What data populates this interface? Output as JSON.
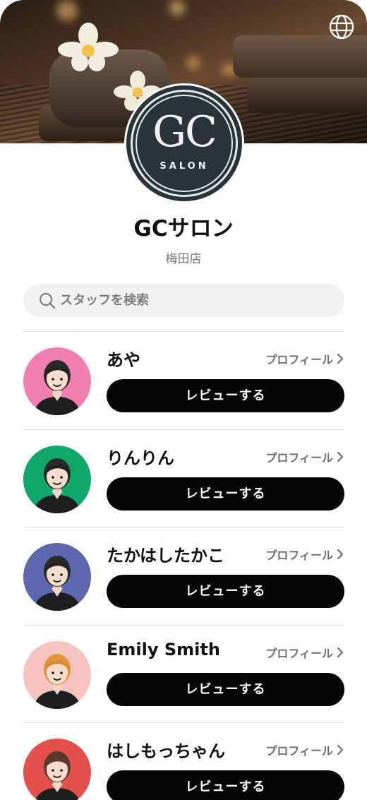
{
  "header": {
    "globe_icon": "globe-icon"
  },
  "logo": {
    "monogram": "GC",
    "subtitle": "SALON"
  },
  "shop": {
    "name": "GCサロン",
    "branch": "梅田店"
  },
  "search": {
    "placeholder": "スタッフを検索",
    "value": ""
  },
  "staff": [
    {
      "name": "あや",
      "profile_label": "プロフィール",
      "review_label": "レビューする",
      "avatar_bg": "#f07fb0"
    },
    {
      "name": "りんりん",
      "profile_label": "プロフィール",
      "review_label": "レビューする",
      "avatar_bg": "#0fa86a"
    },
    {
      "name": "たかはしたかこ",
      "profile_label": "プロフィール",
      "review_label": "レビューする",
      "avatar_bg": "#5e67ad"
    },
    {
      "name": "Emily Smith",
      "profile_label": "プロフィール",
      "review_label": "レビューする",
      "avatar_bg": "#f6c3c0"
    },
    {
      "name": "はしもっちゃん",
      "profile_label": "プロフィール",
      "review_label": "レビューする",
      "avatar_bg": "#e4514c"
    }
  ]
}
